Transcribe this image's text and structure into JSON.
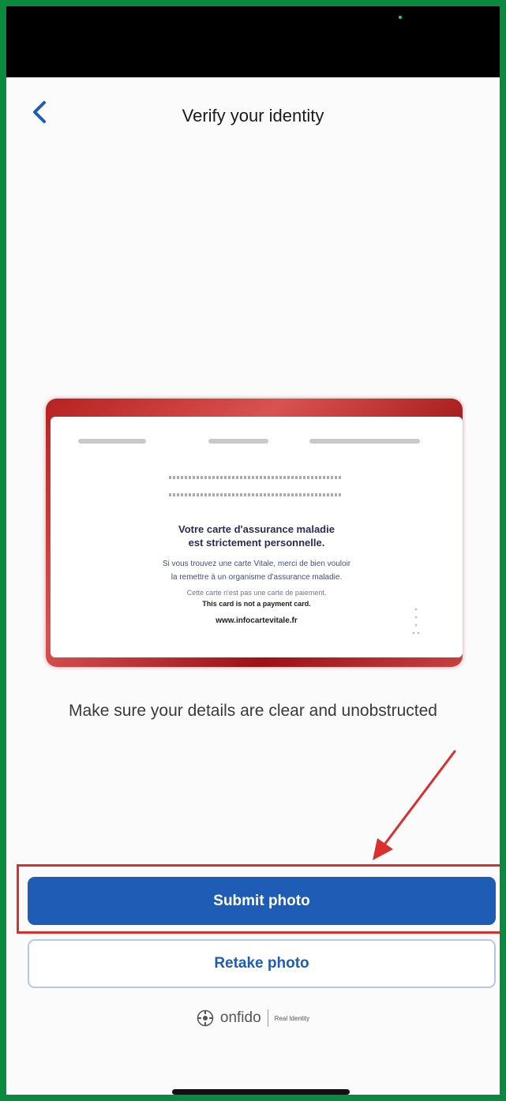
{
  "header": {
    "title": "Verify your identity"
  },
  "card": {
    "heading_line1": "Votre carte d'assurance maladie",
    "heading_line2": "est strictement personnelle.",
    "body_line1": "Si vous trouvez une carte Vitale, merci de bien vouloir",
    "body_line2": "la remettre à un organisme d'assurance maladie.",
    "note_fr": "Cette carte n'est pas une carte de paiement.",
    "note_en": "This card is not a payment card.",
    "website": "www.infocartevitale.fr"
  },
  "instruction": "Make sure your details are clear and unobstructed",
  "actions": {
    "submit_label": "Submit photo",
    "retake_label": "Retake photo"
  },
  "footer": {
    "brand": "onfido",
    "tagline": "Real Identity"
  },
  "colors": {
    "primary": "#1e5cb5",
    "annotation": "#d9302d",
    "frame": "#0a8a3e"
  }
}
